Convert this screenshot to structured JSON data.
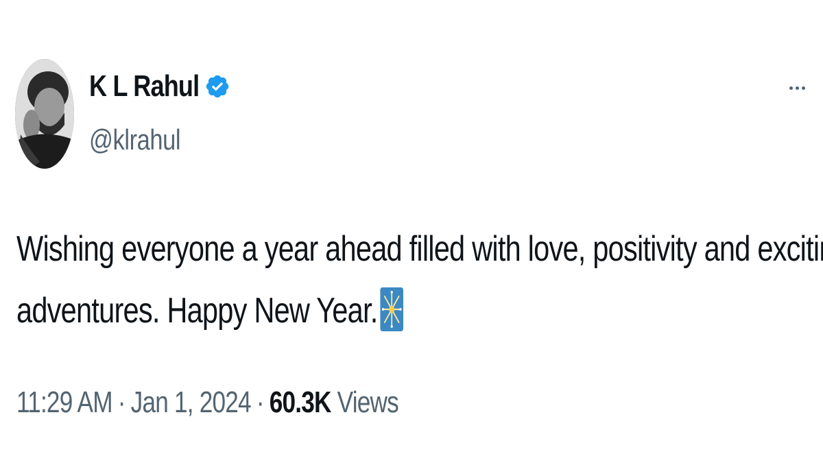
{
  "author": {
    "display_name": "K L Rahul",
    "handle": "@klrahul",
    "verified": true,
    "verified_color": "#1d9bf0"
  },
  "tweet": {
    "text_line1": "Wishing everyone a year ahead filled with love, positivity and exciting",
    "text_line2": "adventures. Happy New Year.",
    "emoji": "sparkler-icon"
  },
  "meta": {
    "time": "11:29 AM",
    "separator": "·",
    "date": "Jan 1, 2024",
    "views_count": "60.3K",
    "views_label": "Views"
  },
  "colors": {
    "text_primary": "#0f1419",
    "text_secondary": "#536471",
    "background": "#ffffff"
  }
}
